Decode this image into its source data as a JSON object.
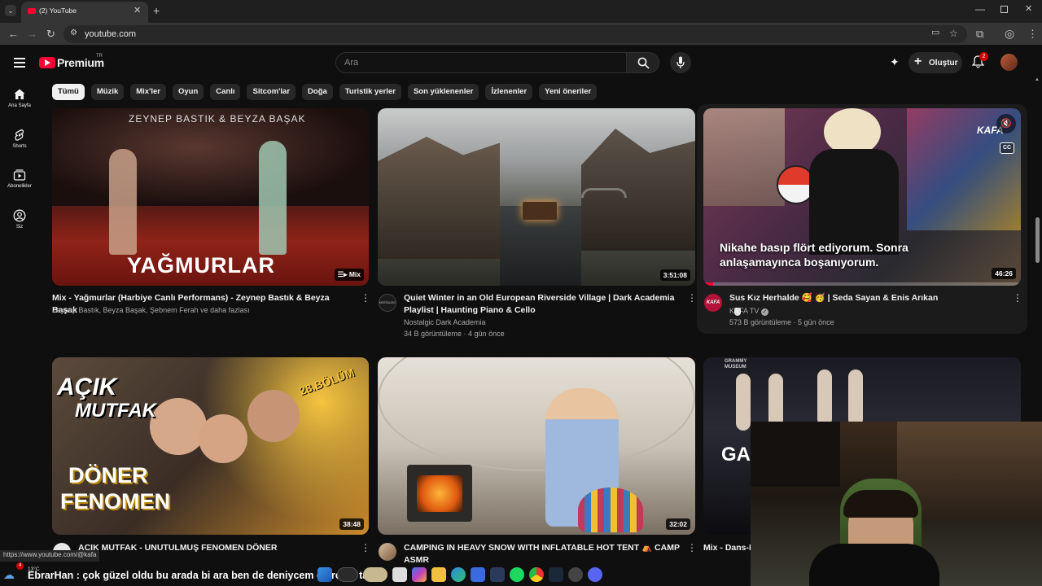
{
  "browser": {
    "tab_title": "(2) YouTube",
    "url": "youtube.com"
  },
  "header": {
    "logo_text": "Premium",
    "region": "TR",
    "search_placeholder": "Ara",
    "create_label": "Oluştur",
    "notification_count": "2"
  },
  "chips": [
    "Tümü",
    "Müzik",
    "Mix'ler",
    "Oyun",
    "Canlı",
    "Sitcom'lar",
    "Doğa",
    "Turistik yerler",
    "Son yüklenenler",
    "İzlenenler",
    "Yeni öneriler"
  ],
  "sidebar": [
    {
      "label": "Ana Sayfa",
      "icon": "home-icon"
    },
    {
      "label": "Shorts",
      "icon": "shorts-icon"
    },
    {
      "label": "Abonelikler",
      "icon": "subscriptions-icon"
    },
    {
      "label": "Siz",
      "icon": "you-icon"
    }
  ],
  "videos": [
    {
      "title": "Mix - Yağmurlar (Harbiye Canlı Performans) - Zeynep Bastık & Beyza Başak",
      "channel": "Zeynep Bastık, Beyza Başak, Şebnem Ferah ve daha fazlası",
      "stats": "",
      "badge": "Mix",
      "thumb_text": "YAĞMURLAR",
      "thumb_top_text": "ZEYNEP BASTIK & BEYZA BAŞAK"
    },
    {
      "title": "Quiet Winter in an Old European Riverside Village | Dark Academia Playlist | Haunting Piano & Cello",
      "channel": "Nostalgic Dark Academia",
      "stats": "34 B görüntüleme · 4 gün önce",
      "badge": "3:51:08",
      "avatar_text": "NOSTALGIC"
    },
    {
      "title": "Sus Kız Herhalde 🥰 🥳 | Seda Sayan & Enis Arıkan",
      "channel": "KAFA TV",
      "stats": "573 B görüntüleme · 5 gün önce",
      "badge": "46:26",
      "caption": "Nikahe basıp flört ediyorum. Sonra anlaşamayınca boşanıyorum.",
      "thumb_corner": "KAFA",
      "cc_label": "CC",
      "avatar_text": "KAFA"
    },
    {
      "title": "AÇIK MUTFAK - UNUTULMUŞ FENOMEN DÖNER",
      "channel": "",
      "stats": "",
      "badge": "38:48",
      "thumb_lines": [
        "AÇIK",
        "MUTFAK",
        "DÖNER",
        "FENOMEN"
      ],
      "episode": "28.BÖLÜM"
    },
    {
      "title": "CAMPING IN HEAVY SNOW WITH INFLATABLE HOT TENT ⛺ CAMP ASMR",
      "channel": "",
      "stats": "",
      "badge": "32:02"
    },
    {
      "title": "Mix - Dans-F",
      "channel": "",
      "stats": "",
      "thumb_text": "GA",
      "thumb_corner": "GRAMMY MUSEUM"
    }
  ],
  "overlay": {
    "status_url": "https://www.youtube.com/@kafa",
    "chat_user": "EbrarHan",
    "chat_message": "çok güzel oldu bu arada bi ara ben de deniycem emrenin tarifi",
    "weather": "13°C",
    "weather_badge": "4"
  },
  "colors": {
    "yt_red": "#ff0033",
    "background": "#0f0f0f",
    "chip_bg": "#272727"
  }
}
